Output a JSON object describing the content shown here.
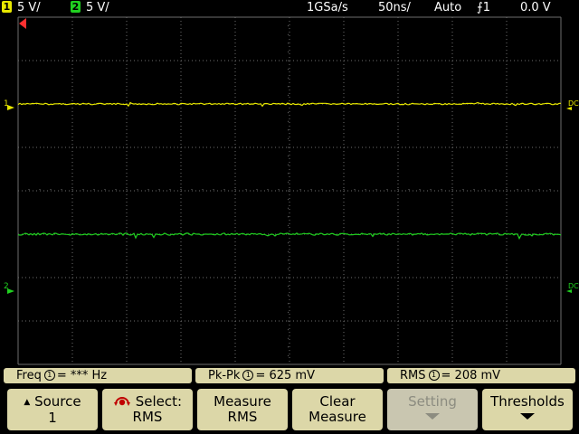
{
  "topbar": {
    "ch1_badge": "1",
    "ch1_scale": "5 V/",
    "ch2_badge": "2",
    "ch2_scale": "5 V/",
    "sample_rate": "1GSa/s",
    "timebase": "50ns/",
    "trigger_mode": "Auto",
    "trigger_source": "1",
    "trigger_level": "0.0 V"
  },
  "colors": {
    "ch1": "#e8e800",
    "ch2": "#20d020",
    "grid": "#6e6e6e",
    "softkey": "#dcd7a8",
    "trigger_marker": "#ff3030"
  },
  "traces": {
    "ch1": {
      "marker": "1",
      "coupling": "DC",
      "level_div": 2.0
    },
    "ch2": {
      "marker": "2",
      "coupling": "DC",
      "level_div": -1.0
    }
  },
  "measurements": [
    {
      "name": "Freq",
      "source": "1",
      "value": "*** Hz"
    },
    {
      "name": "Pk-Pk",
      "source": "1",
      "value": "625 mV"
    },
    {
      "name": "RMS",
      "source": "1",
      "value": "208 mV"
    }
  ],
  "softkeys": [
    {
      "line1": "Source",
      "line2": "1",
      "icon": "up-arrow-icon",
      "enabled": true
    },
    {
      "line1": "Select:",
      "line2": "RMS",
      "icon": "rotary-knob-icon",
      "enabled": true
    },
    {
      "line1": "Measure",
      "line2": "RMS",
      "enabled": true
    },
    {
      "line1": "Clear",
      "line2": "Measure",
      "enabled": true
    },
    {
      "line1": "Setting",
      "line2": "",
      "icon": "down-arrow-icon",
      "enabled": false
    },
    {
      "line1": "Thresholds",
      "line2": "",
      "icon": "down-arrow-icon",
      "enabled": true
    }
  ]
}
